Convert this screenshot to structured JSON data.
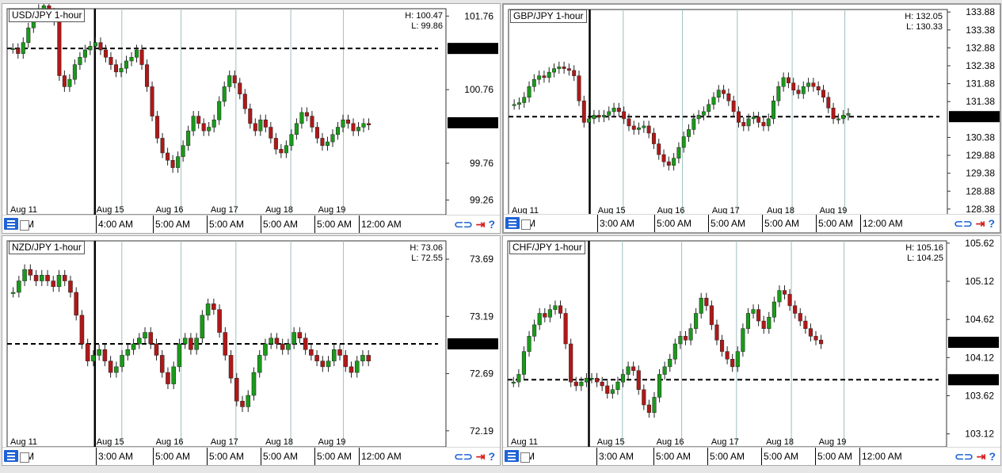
{
  "panels": [
    {
      "title": "USD/JPY 1-hour",
      "high": "H: 100.47",
      "low": "L: 99.86",
      "y_ticks": [
        "101.76",
        "100.76",
        "99.76",
        "99.26"
      ],
      "y_range": [
        99.06,
        101.86
      ],
      "line_level": 101.32,
      "marker_levels": [
        101.32,
        100.31
      ],
      "date_labels": [
        "Aug 11",
        "Aug 15",
        "Aug 16",
        "Aug 17",
        "Aug 18",
        "Aug 19"
      ],
      "time_labels": [
        "PM",
        "4:00 AM",
        "5:00 AM",
        "5:00 AM",
        "5:00 AM",
        "5:00 AM",
        "12:00 AM"
      ],
      "series": [
        101.32,
        101.25,
        101.4,
        101.6,
        101.78,
        101.85,
        101.9,
        101.8,
        101.7,
        100.95,
        100.8,
        100.9,
        101.1,
        101.2,
        101.3,
        101.35,
        101.4,
        101.3,
        101.2,
        101.1,
        101.0,
        101.05,
        101.15,
        101.2,
        101.3,
        101.1,
        100.8,
        100.4,
        100.1,
        99.9,
        99.8,
        99.7,
        99.85,
        100.0,
        100.2,
        100.4,
        100.3,
        100.2,
        100.25,
        100.35,
        100.6,
        100.8,
        100.95,
        100.85,
        100.7,
        100.5,
        100.3,
        100.2,
        100.35,
        100.25,
        100.1,
        99.95,
        99.9,
        100.0,
        100.15,
        100.3,
        100.45,
        100.4,
        100.25,
        100.1,
        100.0,
        100.05,
        100.15,
        100.25,
        100.35,
        100.3,
        100.2,
        100.25,
        100.3,
        100.28
      ],
      "series_x_end": 0.83,
      "bold_line_x": 0.2
    },
    {
      "title": "GBP/JPY 1-hour",
      "high": "H: 132.05",
      "low": "L: 130.33",
      "y_ticks": [
        "133.88",
        "133.38",
        "132.88",
        "132.38",
        "131.88",
        "131.38",
        "130.38",
        "129.88",
        "129.38",
        "128.88",
        "128.38"
      ],
      "y_range": [
        128.2,
        133.95
      ],
      "line_level": 130.96,
      "marker_levels": [
        130.96
      ],
      "date_labels": [
        "Aug 11",
        "Aug 15",
        "Aug 16",
        "Aug 17",
        "Aug 18",
        "Aug 19"
      ],
      "time_labels": [
        "PM",
        "3:00 AM",
        "5:00 AM",
        "5:00 AM",
        "5:00 AM",
        "5:00 AM",
        "12:00 AM"
      ],
      "series": [
        131.3,
        131.35,
        131.5,
        131.8,
        132.0,
        132.1,
        132.05,
        132.2,
        132.3,
        132.35,
        132.3,
        132.25,
        132.1,
        131.4,
        130.8,
        130.9,
        131.0,
        130.95,
        131.0,
        131.1,
        131.2,
        131.1,
        130.9,
        130.7,
        130.6,
        130.65,
        130.7,
        130.5,
        130.2,
        129.9,
        129.7,
        129.6,
        129.8,
        130.1,
        130.4,
        130.6,
        130.9,
        131.0,
        131.1,
        131.3,
        131.5,
        131.7,
        131.6,
        131.4,
        131.1,
        130.8,
        130.7,
        130.9,
        130.95,
        130.8,
        130.7,
        130.9,
        131.4,
        131.8,
        132.05,
        131.9,
        131.7,
        131.6,
        131.8,
        131.9,
        131.8,
        131.7,
        131.5,
        131.2,
        130.9,
        130.9,
        131.0,
        131.05
      ],
      "series_x_end": 0.78,
      "bold_line_x": 0.185
    },
    {
      "title": "NZD/JPY 1-hour",
      "high": "H: 73.06",
      "low": "L: 72.55",
      "y_ticks": [
        "73.69",
        "73.19",
        "72.69",
        "72.19"
      ],
      "y_range": [
        72.05,
        73.85
      ],
      "line_level": 72.95,
      "marker_levels": [
        72.95
      ],
      "date_labels": [
        "Aug 11",
        "Aug 15",
        "Aug 16",
        "Aug 17",
        "Aug 18",
        "Aug 19"
      ],
      "time_labels": [
        "PM",
        "3:00 AM",
        "5:00 AM",
        "5:00 AM",
        "5:00 AM",
        "5:00 AM",
        "12:00 AM"
      ],
      "series": [
        73.4,
        73.5,
        73.6,
        73.55,
        73.5,
        73.55,
        73.5,
        73.45,
        73.55,
        73.5,
        73.4,
        73.2,
        72.95,
        72.8,
        72.85,
        72.9,
        72.8,
        72.7,
        72.75,
        72.85,
        72.9,
        72.95,
        73.0,
        73.05,
        72.95,
        72.85,
        72.7,
        72.6,
        72.75,
        72.95,
        73.0,
        72.9,
        73.0,
        73.2,
        73.3,
        73.25,
        73.05,
        72.85,
        72.65,
        72.45,
        72.4,
        72.5,
        72.7,
        72.85,
        72.95,
        73.0,
        72.95,
        72.9,
        72.95,
        73.05,
        73.0,
        72.9,
        72.85,
        72.8,
        72.75,
        72.8,
        72.9,
        72.85,
        72.75,
        72.7,
        72.8,
        72.85,
        72.8
      ],
      "series_x_end": 0.83,
      "bold_line_x": 0.2
    },
    {
      "title": "CHF/JPY 1-hour",
      "high": "H: 105.16",
      "low": "L: 104.25",
      "y_ticks": [
        "105.62",
        "105.12",
        "104.62",
        "104.12",
        "103.62",
        "103.12"
      ],
      "y_range": [
        102.95,
        105.65
      ],
      "line_level": 103.83,
      "marker_levels": [
        104.32,
        103.83
      ],
      "date_labels": [
        "Aug 11",
        "Aug 15",
        "Aug 16",
        "Aug 17",
        "Aug 18",
        "Aug 19"
      ],
      "time_labels": [
        "PM",
        "3:00 AM",
        "5:00 AM",
        "5:00 AM",
        "5:00 AM",
        "5:00 AM",
        "12:00 AM"
      ],
      "series": [
        103.8,
        103.9,
        104.2,
        104.4,
        104.55,
        104.7,
        104.65,
        104.75,
        104.8,
        104.7,
        104.3,
        103.8,
        103.75,
        103.8,
        103.85,
        103.85,
        103.8,
        103.75,
        103.65,
        103.7,
        103.8,
        103.9,
        104.0,
        103.95,
        103.7,
        103.5,
        103.4,
        103.6,
        103.9,
        104.0,
        104.1,
        104.3,
        104.4,
        104.35,
        104.5,
        104.7,
        104.9,
        104.8,
        104.55,
        104.35,
        104.2,
        104.1,
        104.0,
        104.2,
        104.5,
        104.7,
        104.75,
        104.6,
        104.5,
        104.65,
        104.85,
        105.0,
        104.95,
        104.8,
        104.7,
        104.6,
        104.5,
        104.4,
        104.35,
        104.3
      ],
      "series_x_end": 0.72,
      "bold_line_x": 0.185
    }
  ],
  "colors": {
    "up": "#1a9a1a",
    "down": "#b01818",
    "grid": "#9fbfbf",
    "marker": "#000000"
  },
  "icons": [
    "menu-list-icon",
    "link-icon",
    "jump-to-end-icon",
    "help-icon"
  ],
  "chart_data": [
    {
      "type": "line",
      "title": "USD/JPY 1-hour",
      "high": 100.47,
      "low": 99.86,
      "ylim": [
        99.26,
        101.76
      ],
      "categories": [
        "Aug 11",
        "Aug 15",
        "Aug 16",
        "Aug 17",
        "Aug 18",
        "Aug 19"
      ]
    },
    {
      "type": "line",
      "title": "GBP/JPY 1-hour",
      "high": 132.05,
      "low": 130.33,
      "ylim": [
        128.38,
        133.88
      ],
      "categories": [
        "Aug 11",
        "Aug 15",
        "Aug 16",
        "Aug 17",
        "Aug 18",
        "Aug 19"
      ]
    },
    {
      "type": "line",
      "title": "NZD/JPY 1-hour",
      "high": 73.06,
      "low": 72.55,
      "ylim": [
        72.19,
        73.69
      ],
      "categories": [
        "Aug 11",
        "Aug 15",
        "Aug 16",
        "Aug 17",
        "Aug 18",
        "Aug 19"
      ]
    },
    {
      "type": "line",
      "title": "CHF/JPY 1-hour",
      "high": 105.16,
      "low": 104.25,
      "ylim": [
        103.12,
        105.62
      ],
      "categories": [
        "Aug 11",
        "Aug 15",
        "Aug 16",
        "Aug 17",
        "Aug 18",
        "Aug 19"
      ]
    }
  ]
}
